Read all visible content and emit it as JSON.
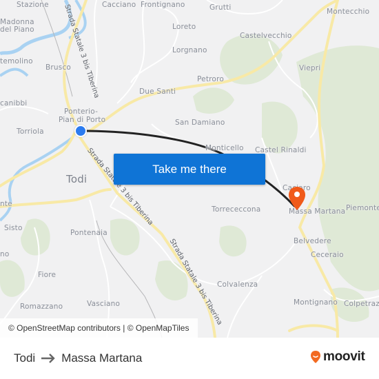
{
  "map": {
    "places": [
      {
        "name": "Stazione",
        "size": "small"
      },
      {
        "name": "Cacciano",
        "size": "small"
      },
      {
        "name": "Frontignano",
        "size": "small"
      },
      {
        "name": "Grutti",
        "size": "small"
      },
      {
        "name": "Montecchio",
        "size": "small"
      },
      {
        "name": "Madonna",
        "size": "small"
      },
      {
        "name": "del Piano",
        "size": "small"
      },
      {
        "name": "Loreto",
        "size": "small"
      },
      {
        "name": "Castelvecchio",
        "size": "small"
      },
      {
        "name": "temolino",
        "size": "small"
      },
      {
        "name": "Lorgnano",
        "size": "small"
      },
      {
        "name": "Brusco",
        "size": "small"
      },
      {
        "name": "Viepri",
        "size": "small"
      },
      {
        "name": "Petroro",
        "size": "small"
      },
      {
        "name": "Due Santi",
        "size": "small"
      },
      {
        "name": "canibbi",
        "size": "small"
      },
      {
        "name": "Ponterio-",
        "size": "small"
      },
      {
        "name": "Pian di Porto",
        "size": "small"
      },
      {
        "name": "Torriola",
        "size": "small"
      },
      {
        "name": "San Damiano",
        "size": "small"
      },
      {
        "name": "Monticello",
        "size": "small"
      },
      {
        "name": "Castel Rinaldi",
        "size": "small"
      },
      {
        "name": "Todi",
        "size": "big"
      },
      {
        "name": "Caciaro",
        "size": "small"
      },
      {
        "name": "nte",
        "size": "small"
      },
      {
        "name": "Torrececcona",
        "size": "small"
      },
      {
        "name": "Massa Martana",
        "size": "small"
      },
      {
        "name": "Piemonte",
        "size": "small"
      },
      {
        "name": "Sisto",
        "size": "small"
      },
      {
        "name": "Pontenaia",
        "size": "small"
      },
      {
        "name": "Belvedere",
        "size": "small"
      },
      {
        "name": "Ceceraio",
        "size": "small"
      },
      {
        "name": "no",
        "size": "small"
      },
      {
        "name": "Fiore",
        "size": "small"
      },
      {
        "name": "Colvalenza",
        "size": "small"
      },
      {
        "name": "Romazzano",
        "size": "small"
      },
      {
        "name": "Vasciano",
        "size": "small"
      },
      {
        "name": "Montignano",
        "size": "small"
      },
      {
        "name": "Colpetrazzo",
        "size": "small"
      }
    ],
    "road_labels": [
      "Strada Statale 3 bis Tiberina",
      "Strada Statale 3 bis Tiberina",
      "Strada Statale 3 bis Tiberina"
    ],
    "origin_marker": {
      "label": "Todi",
      "color": "#2b7bf0"
    },
    "destination_marker": {
      "label": "Massa Martana",
      "color": "#f05a1a"
    },
    "route_color": "#222222"
  },
  "cta": {
    "label": "Take me there",
    "color": "#0f74d6"
  },
  "attribution": "© OpenStreetMap contributors | © OpenMapTiles",
  "footer": {
    "origin": "Todi",
    "destination": "Massa Martana",
    "arrow_icon": "arrow-right-icon",
    "brand": "moovit",
    "brand_color": "#f26a21"
  }
}
